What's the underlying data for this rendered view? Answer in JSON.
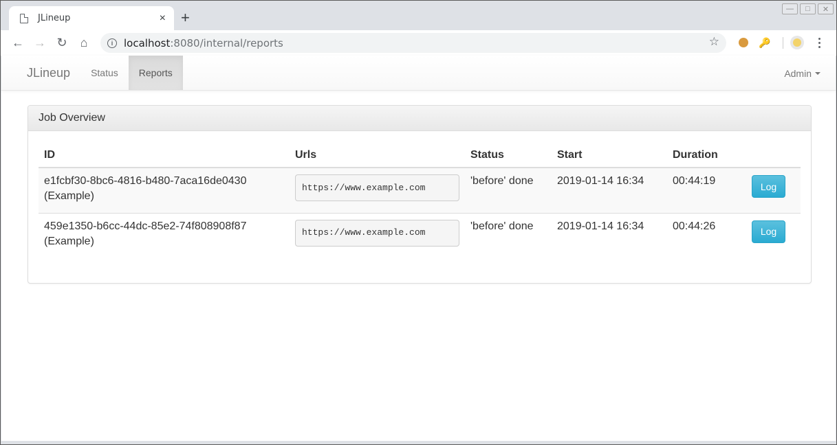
{
  "browser": {
    "tab_title": "JLineup",
    "tab_close": "×",
    "new_tab": "+",
    "url_host": "localhost",
    "url_rest": ":8080/internal/reports",
    "window_controls": {
      "minimize": "—",
      "maximize": "□",
      "close": "✕"
    }
  },
  "navbar": {
    "brand": "JLineup",
    "links": [
      {
        "label": "Status",
        "active": false
      },
      {
        "label": "Reports",
        "active": true
      }
    ],
    "admin_label": "Admin"
  },
  "panel": {
    "title": "Job Overview",
    "columns": [
      "ID",
      "Urls",
      "Status",
      "Start",
      "Duration",
      ""
    ],
    "rows": [
      {
        "id": "e1fcbf30-8bc6-4816-b480-7aca16de0430",
        "name": "(Example)",
        "url": "https://www.example.com",
        "status": "'before' done",
        "start": "2019-01-14 16:34",
        "duration": "00:44:19",
        "action": "Log"
      },
      {
        "id": "459e1350-b6cc-44dc-85e2-74f808908f87",
        "name": "(Example)",
        "url": "https://www.example.com",
        "status": "'before' done",
        "start": "2019-01-14 16:34",
        "duration": "00:44:26",
        "action": "Log"
      }
    ]
  },
  "colors": {
    "log_button": "#5bc0de",
    "navbar_active": "#e2e2e2",
    "text": "#333333"
  }
}
